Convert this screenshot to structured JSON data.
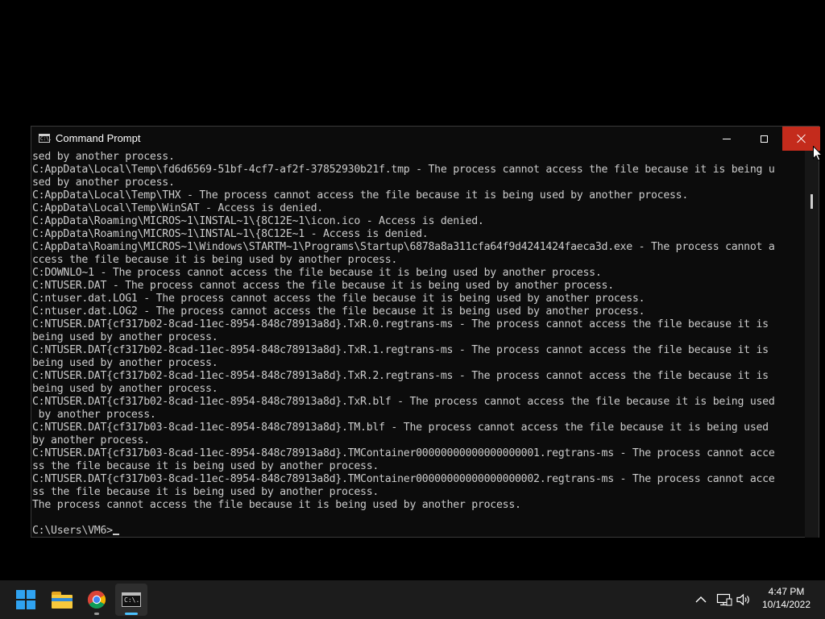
{
  "window": {
    "title": "Command Prompt",
    "icon_label": "C:\\."
  },
  "console": {
    "lines": [
      "sed by another process.",
      "C:AppData\\Local\\Temp\\fd6d6569-51bf-4cf7-af2f-37852930b21f.tmp - The process cannot access the file because it is being u",
      "sed by another process.",
      "C:AppData\\Local\\Temp\\THX - The process cannot access the file because it is being used by another process.",
      "C:AppData\\Local\\Temp\\WinSAT - Access is denied.",
      "C:AppData\\Roaming\\MICROS~1\\INSTAL~1\\{8C12E~1\\icon.ico - Access is denied.",
      "C:AppData\\Roaming\\MICROS~1\\INSTAL~1\\{8C12E~1 - Access is denied.",
      "C:AppData\\Roaming\\MICROS~1\\Windows\\STARTM~1\\Programs\\Startup\\6878a8a311cfa64f9d4241424faeca3d.exe - The process cannot a",
      "ccess the file because it is being used by another process.",
      "C:DOWNLO~1 - The process cannot access the file because it is being used by another process.",
      "C:NTUSER.DAT - The process cannot access the file because it is being used by another process.",
      "C:ntuser.dat.LOG1 - The process cannot access the file because it is being used by another process.",
      "C:ntuser.dat.LOG2 - The process cannot access the file because it is being used by another process.",
      "C:NTUSER.DAT{cf317b02-8cad-11ec-8954-848c78913a8d}.TxR.0.regtrans-ms - The process cannot access the file because it is",
      "being used by another process.",
      "C:NTUSER.DAT{cf317b02-8cad-11ec-8954-848c78913a8d}.TxR.1.regtrans-ms - The process cannot access the file because it is",
      "being used by another process.",
      "C:NTUSER.DAT{cf317b02-8cad-11ec-8954-848c78913a8d}.TxR.2.regtrans-ms - The process cannot access the file because it is",
      "being used by another process.",
      "C:NTUSER.DAT{cf317b02-8cad-11ec-8954-848c78913a8d}.TxR.blf - The process cannot access the file because it is being used",
      " by another process.",
      "C:NTUSER.DAT{cf317b03-8cad-11ec-8954-848c78913a8d}.TM.blf - The process cannot access the file because it is being used",
      "by another process.",
      "C:NTUSER.DAT{cf317b03-8cad-11ec-8954-848c78913a8d}.TMContainer00000000000000000001.regtrans-ms - The process cannot acce",
      "ss the file because it is being used by another process.",
      "C:NTUSER.DAT{cf317b03-8cad-11ec-8954-848c78913a8d}.TMContainer00000000000000000002.regtrans-ms - The process cannot acce",
      "ss the file because it is being used by another process.",
      "The process cannot access the file because it is being used by another process.",
      ""
    ],
    "prompt": "C:\\Users\\VM6>"
  },
  "taskbar": {
    "apps": [
      {
        "name": "start",
        "icon": "windows-start-icon"
      },
      {
        "name": "file-explorer",
        "icon": "folder-icon"
      },
      {
        "name": "chrome",
        "icon": "chrome-icon"
      },
      {
        "name": "command-prompt",
        "icon": "cmd-icon",
        "active": true
      }
    ],
    "clock": {
      "time": "4:47 PM",
      "date": "10/14/2022"
    }
  },
  "colors": {
    "close_button": "#c42b1c",
    "console_text": "#cccccc",
    "taskbar_bg": "#1c1c1c",
    "active_indicator": "#4cc2ff"
  }
}
